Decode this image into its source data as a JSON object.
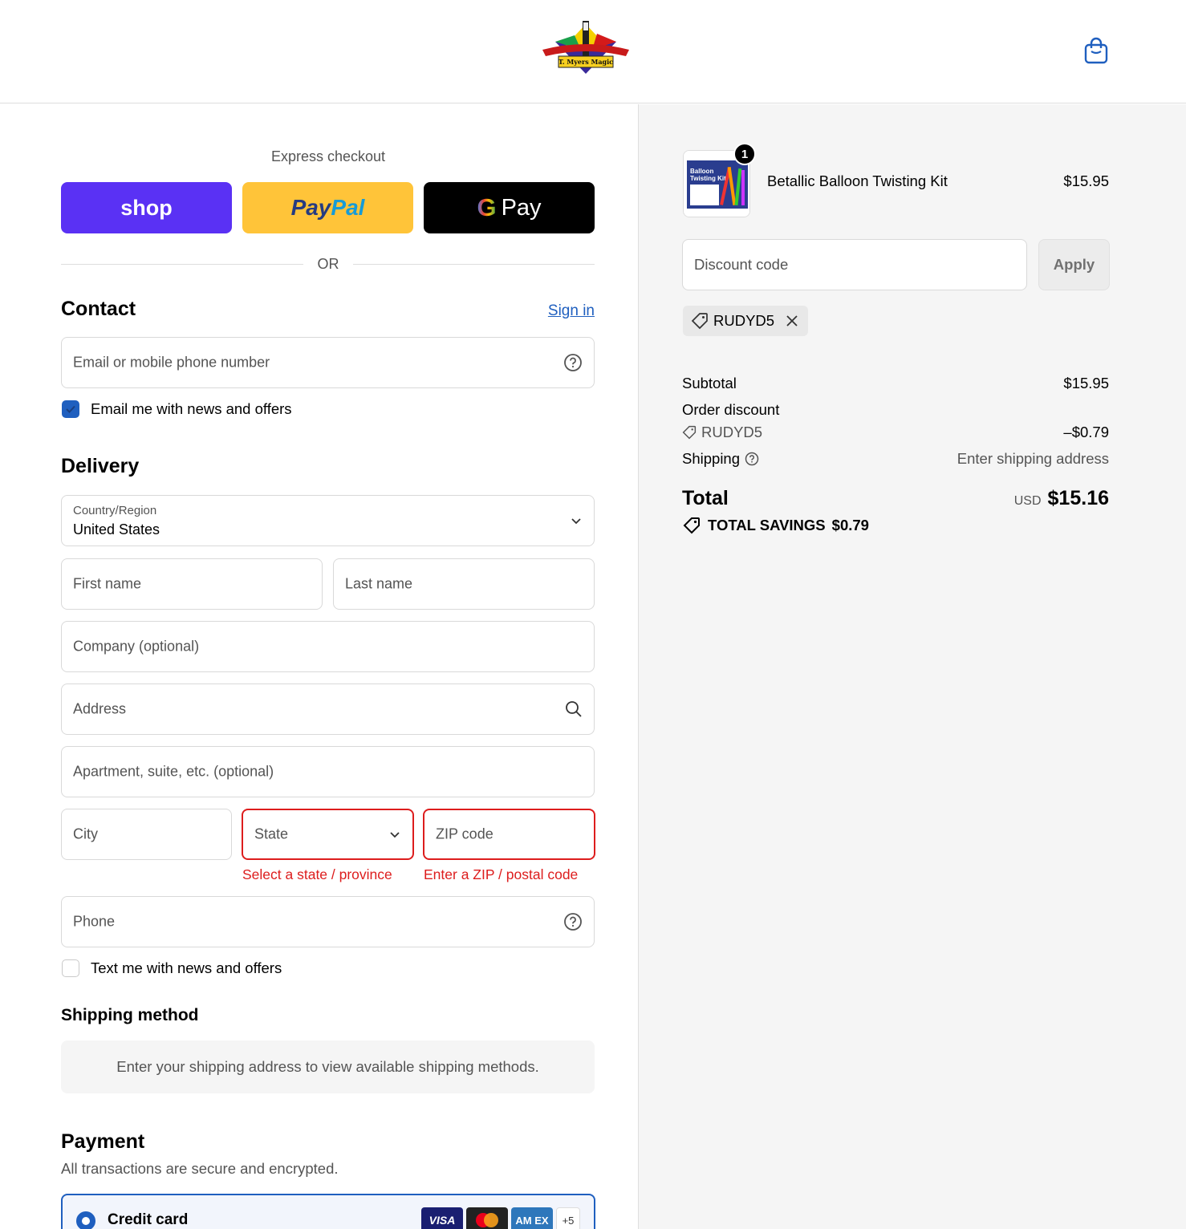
{
  "header": {
    "logo_text": "T. Myers Magic",
    "cart_icon": "shopping-bag-icon"
  },
  "express": {
    "label": "Express checkout",
    "shop_label": "shop",
    "paypal_label_1": "Pay",
    "paypal_label_2": "Pal",
    "gpay_g": "G",
    "gpay_label": "Pay",
    "or_label": "OR"
  },
  "contact": {
    "title": "Contact",
    "sign_in": "Sign in",
    "email_placeholder": "Email or mobile phone number",
    "news_label": "Email me with news and offers",
    "news_checked": true
  },
  "delivery": {
    "title": "Delivery",
    "country_label": "Country/Region",
    "country_value": "United States",
    "first_name": "First name",
    "last_name": "Last name",
    "company": "Company (optional)",
    "address": "Address",
    "apartment": "Apartment, suite, etc. (optional)",
    "city": "City",
    "state": "State",
    "zip": "ZIP code",
    "state_error": "Select a state / province",
    "zip_error": "Enter a ZIP / postal code",
    "phone": "Phone",
    "text_label": "Text me with news and offers",
    "text_checked": false
  },
  "shipping_method": {
    "title": "Shipping method",
    "message": "Enter your shipping address to view available shipping methods."
  },
  "payment": {
    "title": "Payment",
    "subtitle": "All transactions are secure and encrypted.",
    "credit_card_label": "Credit card",
    "card_logos": [
      "VISA",
      "",
      "AM EX"
    ],
    "more_cards": "+5"
  },
  "summary": {
    "product": {
      "quantity": "1",
      "name": "Betallic Balloon Twisting Kit",
      "price": "$15.95",
      "thumb_lines": [
        "Balloon",
        "Twisting Kit"
      ]
    },
    "discount_placeholder": "Discount code",
    "apply_label": "Apply",
    "applied_code": "RUDYD5",
    "subtotal_label": "Subtotal",
    "subtotal_value": "$15.95",
    "order_discount_label": "Order discount",
    "discount_code": "RUDYD5",
    "discount_value": "–$0.79",
    "shipping_label": "Shipping",
    "shipping_value": "Enter shipping address",
    "total_label": "Total",
    "currency": "USD",
    "total_value": "$15.16",
    "savings_label": "TOTAL SAVINGS",
    "savings_value": "$0.79"
  },
  "colors": {
    "shop": "#5a31f4",
    "paypal": "#ffc439",
    "accent": "#1f5fbf",
    "error": "#dd1d1d"
  }
}
